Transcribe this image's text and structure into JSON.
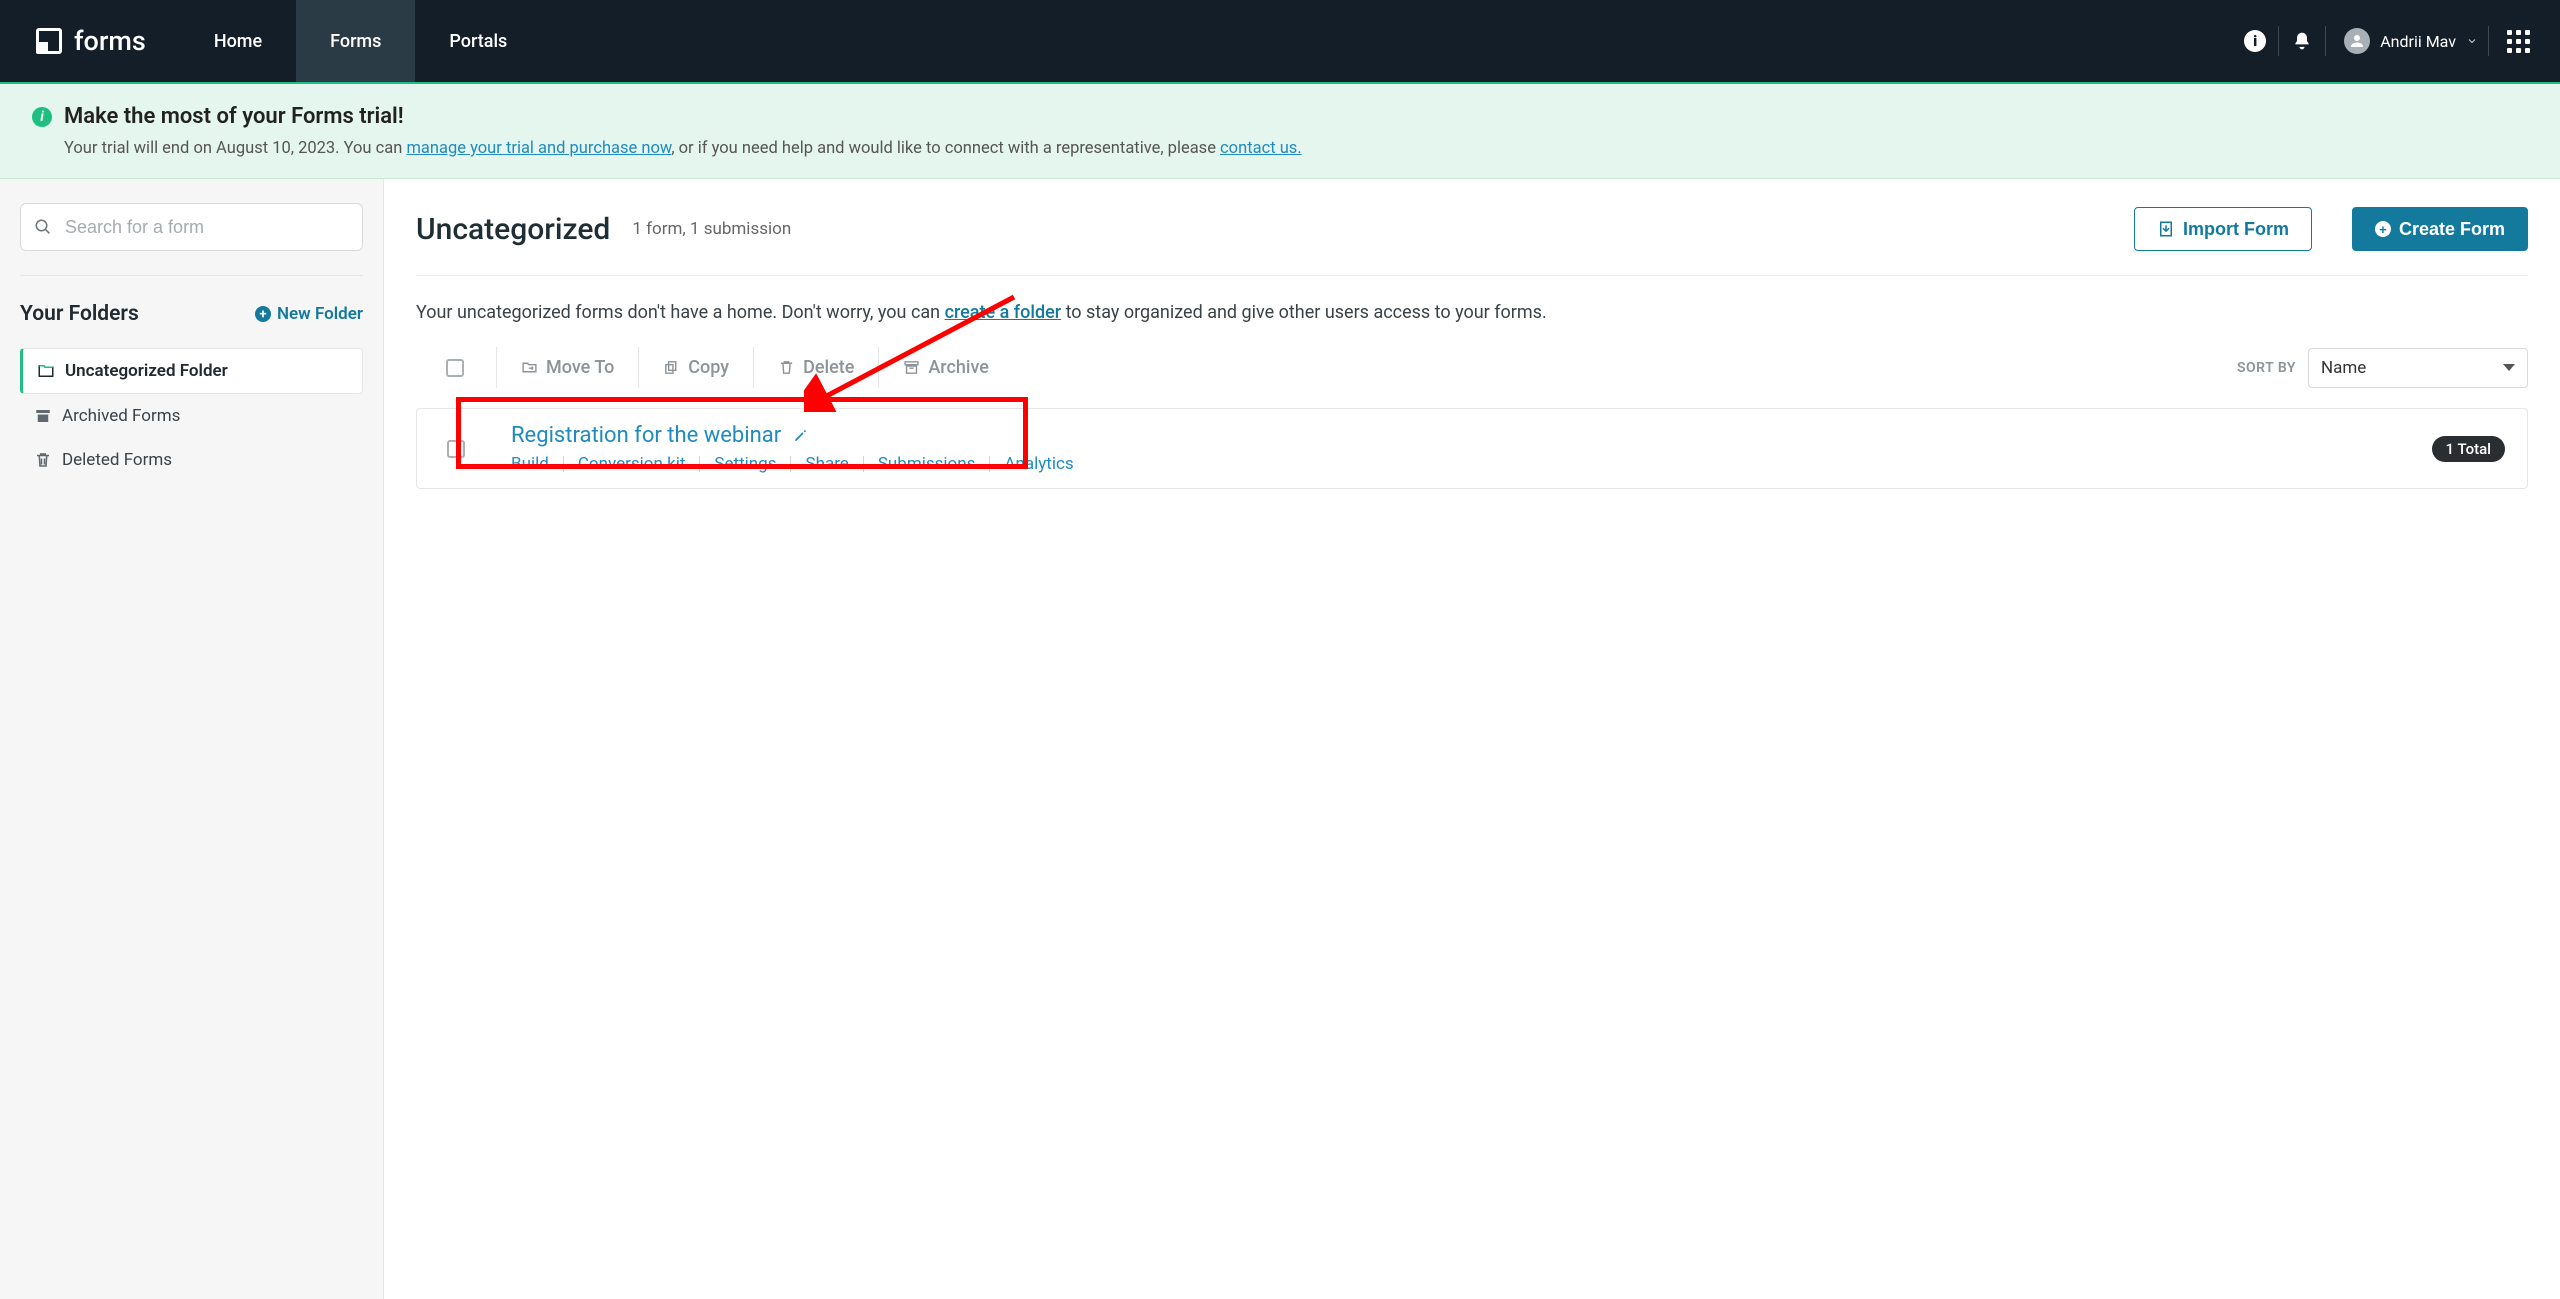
{
  "brand": {
    "name": "forms"
  },
  "nav": {
    "tabs": [
      {
        "label": "Home"
      },
      {
        "label": "Forms"
      },
      {
        "label": "Portals"
      }
    ],
    "user_name": "Andrii Mav"
  },
  "trial_banner": {
    "title": "Make the most of your Forms trial!",
    "prefix": "Your trial will end on August 10, 2023. You can ",
    "link1": "manage your trial and purchase now",
    "middle": ", or if you need help and would like to connect with a representative, please ",
    "link2": "contact us."
  },
  "sidebar": {
    "search_placeholder": "Search for a form",
    "folders_heading": "Your Folders",
    "new_folder": "New Folder",
    "items": [
      {
        "label": "Uncategorized Folder"
      },
      {
        "label": "Archived Forms"
      },
      {
        "label": "Deleted Forms"
      }
    ]
  },
  "main": {
    "title": "Uncategorized",
    "subtitle": "1 form, 1 submission",
    "import_btn": "Import Form",
    "create_btn": "Create Form",
    "info_prefix": "Your uncategorized forms don't have a home. Don't worry, you can ",
    "info_link": "create a folder",
    "info_suffix": " to stay organized and give other users access to your forms."
  },
  "toolbar": {
    "move_to": "Move To",
    "copy": "Copy",
    "delete": "Delete",
    "archive": "Archive",
    "sort_label": "SORT BY",
    "sort_value": "Name"
  },
  "form_row": {
    "title": "Registration for the webinar",
    "links": [
      "Build",
      "Conversion kit",
      "Settings",
      "Share",
      "Submissions",
      "Analytics"
    ],
    "total": "1 Total"
  }
}
